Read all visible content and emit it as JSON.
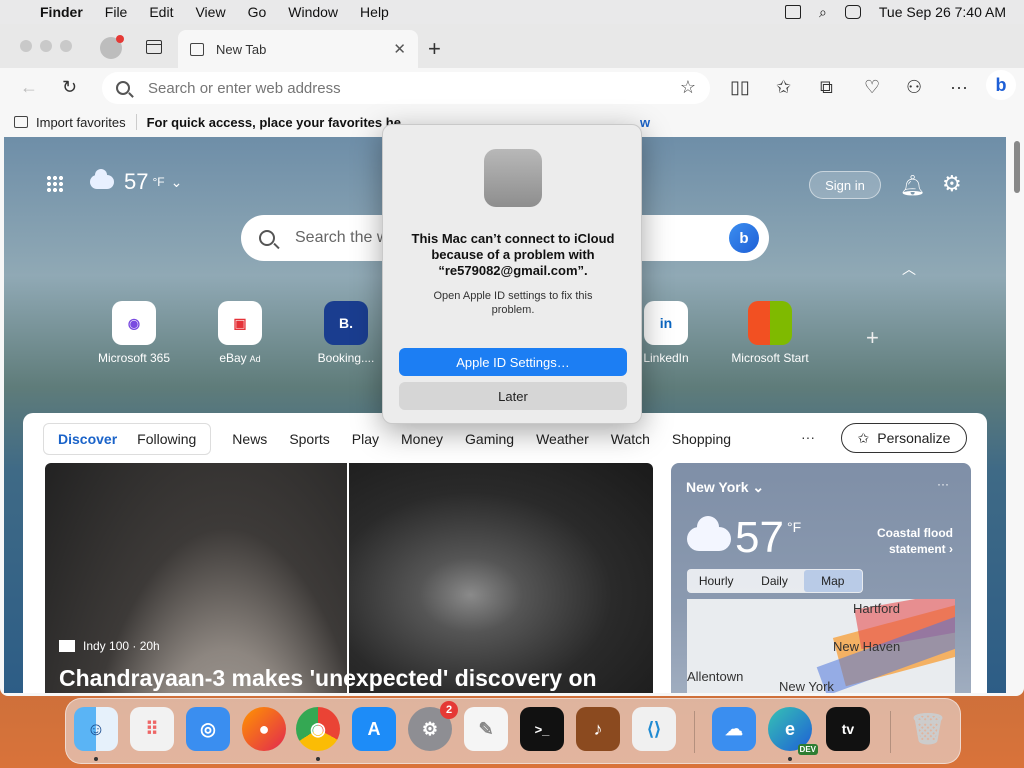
{
  "menubar": {
    "app": "Finder",
    "items": [
      "File",
      "Edit",
      "View",
      "Go",
      "Window",
      "Help"
    ],
    "clock": "Tue Sep 26  7:40 AM"
  },
  "browser": {
    "tab_title": "New Tab",
    "address_placeholder": "Search or enter web address",
    "favbar": {
      "import": "Import favorites",
      "hint": "For quick access, place your favorites he",
      "manage": "w"
    }
  },
  "newtab": {
    "weather": {
      "temp": "57",
      "unit": "°F"
    },
    "signin": "Sign in",
    "search_placeholder": "Search the w",
    "quicklinks": [
      {
        "label": "Microsoft 365",
        "ad": ""
      },
      {
        "label": "eBay",
        "ad": "Ad"
      },
      {
        "label": "Booking....",
        "ad": ""
      },
      {
        "label": "LinkedIn",
        "ad": ""
      },
      {
        "label": "Microsoft Start",
        "ad": ""
      }
    ],
    "feed_tabs": {
      "discover": "Discover",
      "following": "Following",
      "others": [
        "News",
        "Sports",
        "Play",
        "Money",
        "Gaming",
        "Weather",
        "Watch",
        "Shopping"
      ],
      "personalize": "Personalize"
    },
    "hero": {
      "source": "Indy 100 · 20h",
      "headline": "Chandrayaan-3 makes 'unexpected' discovery on"
    },
    "weather_card": {
      "city": "New York",
      "temp": "57",
      "unit": "°F",
      "alert": "Coastal flood statement",
      "tabs": [
        "Hourly",
        "Daily",
        "Map"
      ],
      "map_labels": [
        "Hartford",
        "New Haven",
        "Allentown",
        "New York"
      ]
    }
  },
  "dialog": {
    "title": "This Mac can’t connect to iCloud because of a problem with “re579082@gmail.com”.",
    "message": "Open Apple ID settings to fix this problem.",
    "primary": "Apple ID Settings…",
    "secondary": "Later"
  },
  "dock": {
    "settings_badge": "2",
    "edge_label": "DEV"
  }
}
